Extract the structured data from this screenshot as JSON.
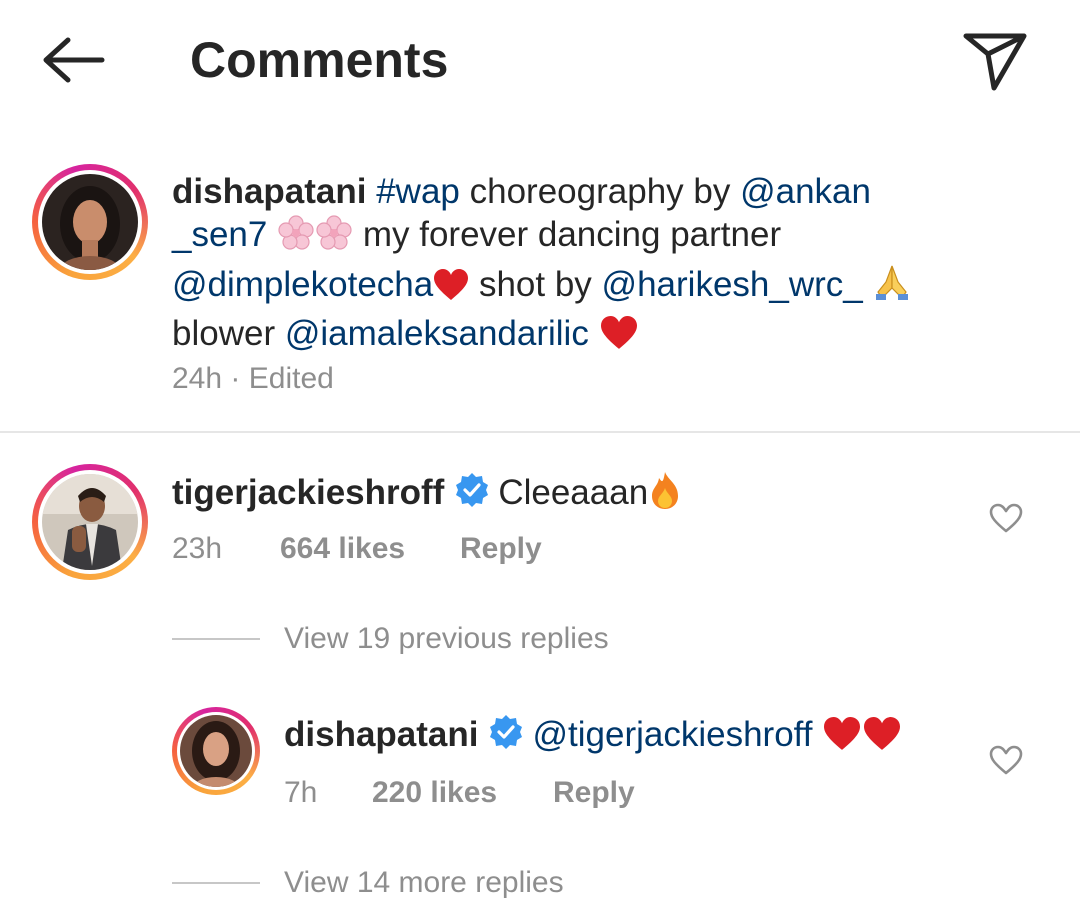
{
  "header": {
    "title": "Comments",
    "back_icon": "arrow-left-icon",
    "send_icon": "paper-plane-icon"
  },
  "caption": {
    "username": "dishapatani",
    "hashtag": "#wap",
    "text_1": "choreography by",
    "mention_1": "@ankan _sen7",
    "text_2": "my forever dancing partner",
    "mention_2": "@dimplekotecha",
    "text_3": "shot by",
    "mention_3": "@harikesh_wrc_",
    "text_4": "blower",
    "mention_4": "@iamaleksandarilic",
    "time": "24h",
    "separator": "·",
    "edited": "Edited",
    "emojis": [
      "cherry-blossom",
      "cherry-blossom",
      "red-heart",
      "folded-hands",
      "red-heart"
    ]
  },
  "comment_1": {
    "username": "tigerjackieshroff",
    "verified": true,
    "text": "Cleeaaan",
    "emoji": "fire",
    "time": "23h",
    "likes": "664 likes",
    "reply": "Reply"
  },
  "view_previous": "View 19 previous replies",
  "reply_1": {
    "username": "dishapatani",
    "verified": true,
    "mention": "@tigerjackieshroff",
    "emojis": [
      "red-heart",
      "red-heart"
    ],
    "time": "7h",
    "likes": "220 likes",
    "reply": "Reply"
  },
  "view_more": "View 14 more replies",
  "colors": {
    "text": "#262626",
    "link": "#00376b",
    "muted": "#8e8e8e",
    "verified": "#3897f0",
    "heart": "#ed1c24"
  }
}
